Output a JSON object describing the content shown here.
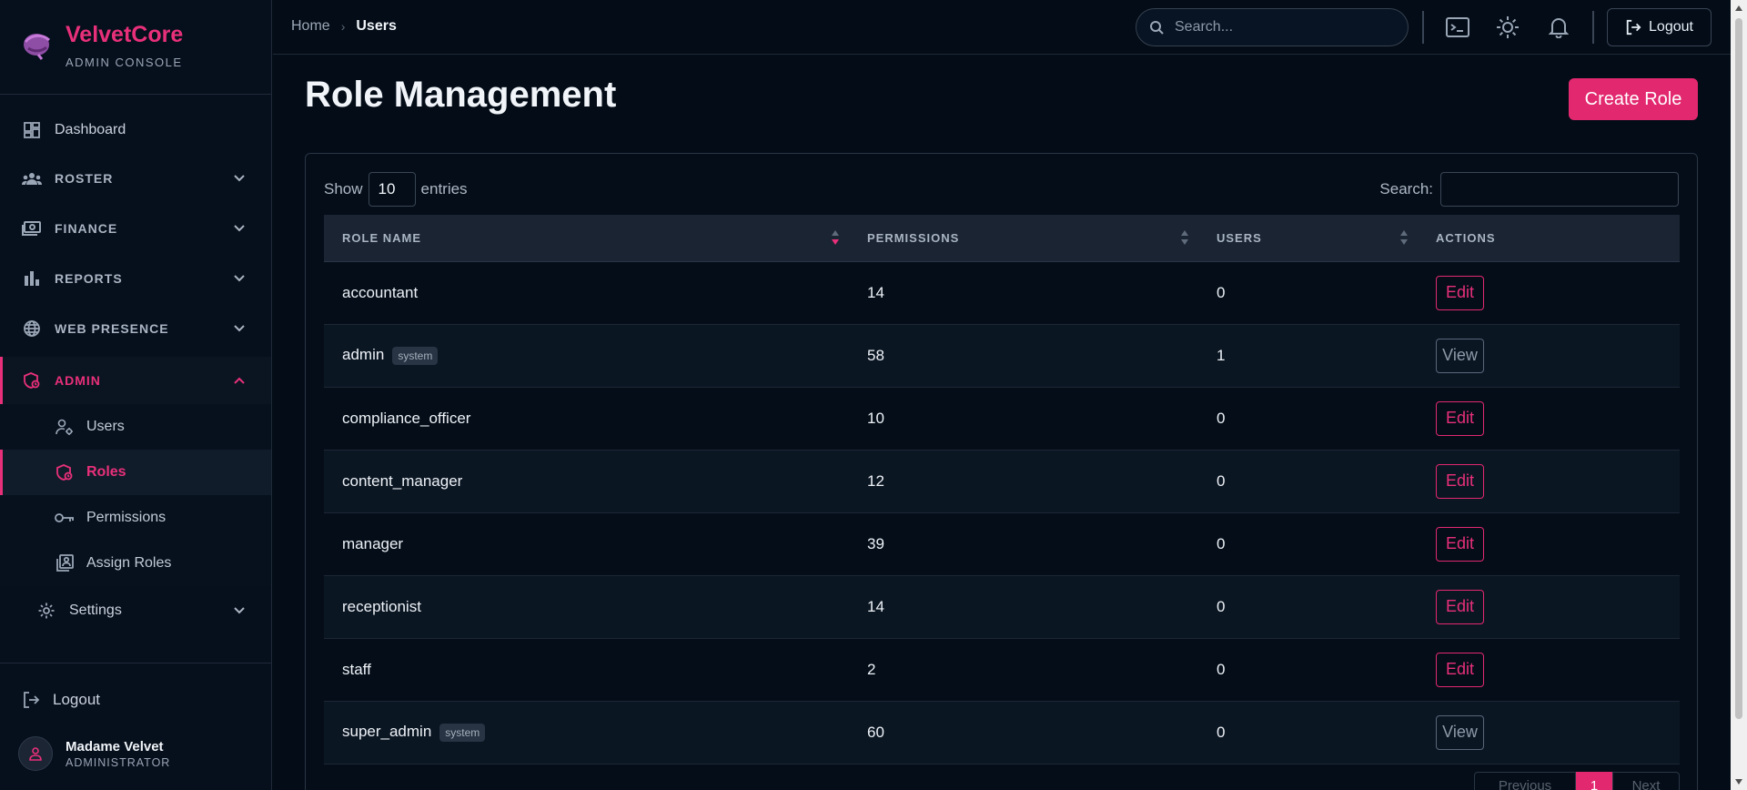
{
  "brand": {
    "name": "VelvetCore",
    "subtitle": "ADMIN CONSOLE"
  },
  "sidebar": {
    "items": [
      {
        "label": "Dashboard",
        "icon": "dashboard-icon"
      },
      {
        "label": "ROSTER",
        "icon": "roster-icon"
      },
      {
        "label": "FINANCE",
        "icon": "finance-icon"
      },
      {
        "label": "REPORTS",
        "icon": "reports-icon"
      },
      {
        "label": "WEB PRESENCE",
        "icon": "globe-icon"
      },
      {
        "label": "ADMIN",
        "icon": "admin-shield-icon"
      }
    ],
    "admin_sub": [
      {
        "label": "Users",
        "icon": "user-gear-icon"
      },
      {
        "label": "Roles",
        "icon": "role-shield-icon"
      },
      {
        "label": "Permissions",
        "icon": "key-icon"
      },
      {
        "label": "Assign Roles",
        "icon": "assign-roles-icon"
      }
    ],
    "settings": {
      "label": "Settings",
      "icon": "gear-icon"
    },
    "logout": "Logout",
    "user": {
      "name": "Madame Velvet",
      "role": "ADMINISTRATOR"
    }
  },
  "topbar": {
    "breadcrumb": {
      "home": "Home",
      "current": "Users"
    },
    "search_placeholder": "Search...",
    "logout": "Logout"
  },
  "page": {
    "title": "Role Management",
    "create_button": "Create Role"
  },
  "table": {
    "show_label": "Show",
    "entries_value": "10",
    "entries_label": "entries",
    "search_label": "Search:",
    "columns": [
      "ROLE NAME",
      "PERMISSIONS",
      "USERS",
      "ACTIONS"
    ],
    "rows": [
      {
        "role": "accountant",
        "badge": "",
        "permissions": "14",
        "users": "0",
        "action": "Edit"
      },
      {
        "role": "admin",
        "badge": "system",
        "permissions": "58",
        "users": "1",
        "action": "View"
      },
      {
        "role": "compliance_officer",
        "badge": "",
        "permissions": "10",
        "users": "0",
        "action": "Edit"
      },
      {
        "role": "content_manager",
        "badge": "",
        "permissions": "12",
        "users": "0",
        "action": "Edit"
      },
      {
        "role": "manager",
        "badge": "",
        "permissions": "39",
        "users": "0",
        "action": "Edit"
      },
      {
        "role": "receptionist",
        "badge": "",
        "permissions": "14",
        "users": "0",
        "action": "Edit"
      },
      {
        "role": "staff",
        "badge": "",
        "permissions": "2",
        "users": "0",
        "action": "Edit"
      },
      {
        "role": "super_admin",
        "badge": "system",
        "permissions": "60",
        "users": "0",
        "action": "View"
      }
    ],
    "pagination": {
      "previous": "Previous",
      "current": "1",
      "next": "Next"
    }
  },
  "colors": {
    "accent": "#e2286f",
    "background": "#030c17",
    "sidebar": "#060f1c"
  }
}
